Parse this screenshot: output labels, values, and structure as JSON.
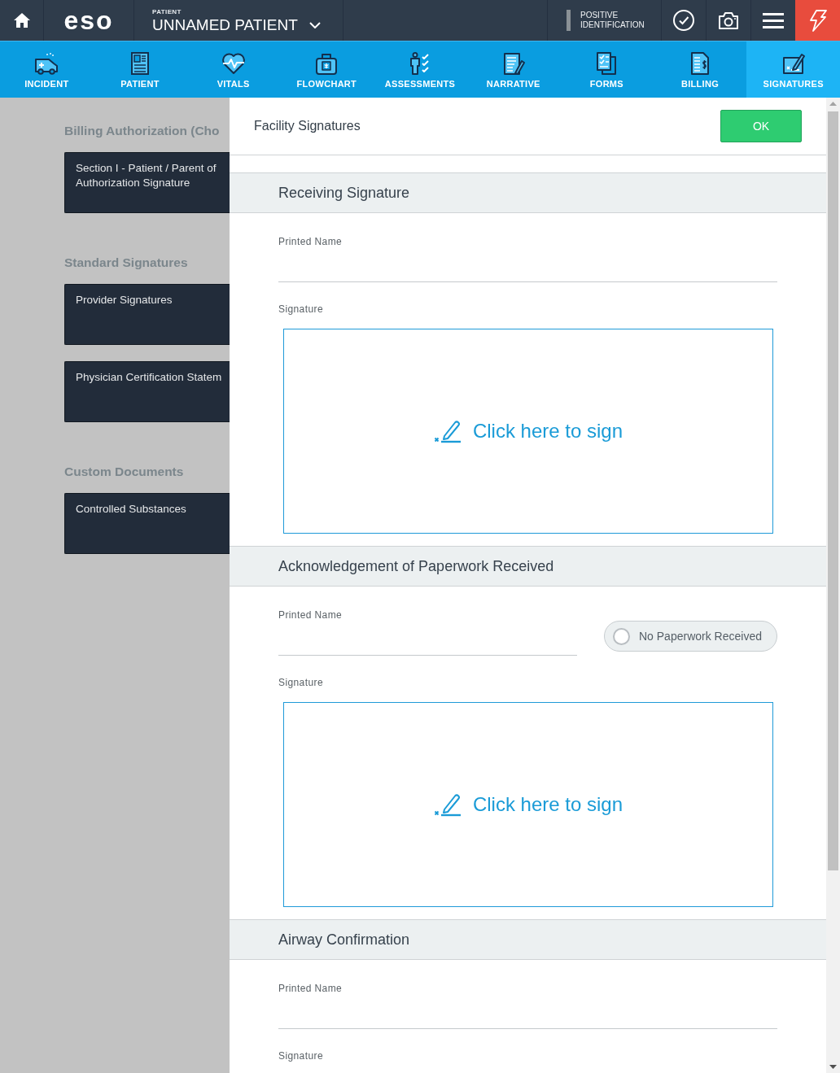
{
  "top_bar": {
    "logo": "eso",
    "patient_label": "PATIENT",
    "patient_name": "UNNAMED PATIENT",
    "identification": "POSITIVE IDENTIFICATION"
  },
  "nav_tabs": [
    {
      "label": "INCIDENT",
      "selected": false
    },
    {
      "label": "PATIENT",
      "selected": false
    },
    {
      "label": "VITALS",
      "selected": false
    },
    {
      "label": "FLOWCHART",
      "selected": false
    },
    {
      "label": "ASSESSMENTS",
      "selected": false
    },
    {
      "label": "NARRATIVE",
      "selected": false
    },
    {
      "label": "FORMS",
      "selected": false
    },
    {
      "label": "BILLING",
      "selected": false
    },
    {
      "label": "SIGNATURES",
      "selected": true
    }
  ],
  "left_panel": [
    {
      "heading": "Billing Authorization (Cho",
      "items": [
        "Section I - Patient / Parent of\nAuthorization Signature"
      ]
    },
    {
      "heading": "Standard Signatures",
      "items": [
        "Provider Signatures",
        "Physician Certification Statem"
      ]
    },
    {
      "heading": "Custom Documents",
      "items": [
        "Controlled Substances"
      ]
    }
  ],
  "modal": {
    "title": "Facility Signatures",
    "ok_button": "OK",
    "sections": [
      {
        "title": "Receiving Signature",
        "printed_name_label": "Printed Name",
        "signature_label": "Signature",
        "sign_prompt": "Click here to sign"
      },
      {
        "title": "Acknowledgement of Paperwork Received",
        "printed_name_label": "Printed Name",
        "toggle": {
          "label": "No Paperwork Received",
          "checked": false
        },
        "signature_label": "Signature",
        "sign_prompt": "Click here to sign"
      },
      {
        "title": "Airway Confirmation",
        "printed_name_label": "Printed Name",
        "signature_label": "Signature"
      }
    ]
  }
}
